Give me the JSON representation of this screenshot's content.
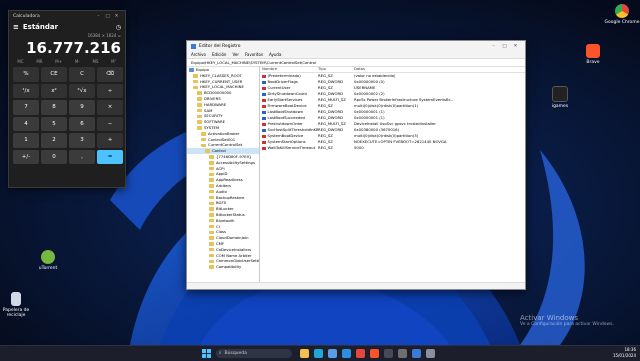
{
  "desktop": {
    "icons": [
      {
        "label": "Google Chrome",
        "color": "#e8453c"
      },
      {
        "label": "Brave",
        "color": "#fb542b"
      },
      {
        "label": "igames",
        "color": "#222222"
      },
      {
        "label": "uTorrent",
        "color": "#76b83f"
      },
      {
        "label": "Papelera de reciclaje",
        "color": "#cfd8e6"
      }
    ],
    "watermark": {
      "line1": "Activar Windows",
      "line2": "Ve a Configuración para activar Windows."
    }
  },
  "calculator": {
    "title": "Calculadora",
    "mode": "Estándar",
    "expression": "16384 × 1024 =",
    "display": "16.777.216",
    "memory": [
      "MC",
      "MR",
      "M+",
      "M-",
      "MS",
      "M˅"
    ],
    "keys": [
      "%",
      "CE",
      "C",
      "⌫",
      "¹/x",
      "x²",
      "²√x",
      "÷",
      "7",
      "8",
      "9",
      "×",
      "4",
      "5",
      "6",
      "−",
      "1",
      "2",
      "3",
      "+",
      "+/-",
      "0",
      ",",
      "="
    ],
    "accent": "#4cc2ff"
  },
  "regedit": {
    "title": "Editor del Registro",
    "menu": [
      "Archivo",
      "Edición",
      "Ver",
      "Favoritos",
      "Ayuda"
    ],
    "address": "Equipo\\HKEY_LOCAL_MACHINE\\SYSTEM\\CurrentControlSet\\Control",
    "tree": [
      {
        "label": "Equipo",
        "indent": 0
      },
      {
        "label": "HKEY_CLASSES_ROOT",
        "indent": 1
      },
      {
        "label": "HKEY_CURRENT_USER",
        "indent": 1
      },
      {
        "label": "HKEY_LOCAL_MACHINE",
        "indent": 1
      },
      {
        "label": "BCD00000000",
        "indent": 2
      },
      {
        "label": "DRIVERS",
        "indent": 2
      },
      {
        "label": "HARDWARE",
        "indent": 2
      },
      {
        "label": "SAM",
        "indent": 2
      },
      {
        "label": "SECURITY",
        "indent": 2
      },
      {
        "label": "SOFTWARE",
        "indent": 2
      },
      {
        "label": "SYSTEM",
        "indent": 2
      },
      {
        "label": "ActivationBroker",
        "indent": 3
      },
      {
        "label": "ControlSet001",
        "indent": 3
      },
      {
        "label": "CurrentControlSet",
        "indent": 3
      },
      {
        "label": "Control",
        "indent": 4,
        "selected": true
      },
      {
        "label": "{7746D80F-97E0}",
        "indent": 5
      },
      {
        "label": "AccessibilitySettings",
        "indent": 5
      },
      {
        "label": "ACPI",
        "indent": 5
      },
      {
        "label": "AppID",
        "indent": 5
      },
      {
        "label": "AppReadiness",
        "indent": 5
      },
      {
        "label": "Arbiters",
        "indent": 5
      },
      {
        "label": "Audio",
        "indent": 5
      },
      {
        "label": "BackupRestore",
        "indent": 5
      },
      {
        "label": "BGFX",
        "indent": 5
      },
      {
        "label": "BitLocker",
        "indent": 5
      },
      {
        "label": "BitlockerStatus",
        "indent": 5
      },
      {
        "label": "Bluetooth",
        "indent": 5
      },
      {
        "label": "CI",
        "indent": 5
      },
      {
        "label": "Class",
        "indent": 5
      },
      {
        "label": "CloudDomainJoin",
        "indent": 5
      },
      {
        "label": "CMF",
        "indent": 5
      },
      {
        "label": "CoDeviceInstallers",
        "indent": 5
      },
      {
        "label": "COM Name Arbiter",
        "indent": 5
      },
      {
        "label": "CommonGlobUserSettings",
        "indent": 5
      },
      {
        "label": "Compatibility",
        "indent": 5
      }
    ],
    "columns": [
      "Nombre",
      "Tipo",
      "Datos"
    ],
    "values": [
      {
        "name": "(Predeterminado)",
        "type": "REG_SZ",
        "data": "(valor no establecido)",
        "icon": "ab"
      },
      {
        "name": "BootDriverFlags",
        "type": "REG_DWORD",
        "data": "0x00000000 (0)",
        "icon": "bin"
      },
      {
        "name": "CurrentUser",
        "type": "REG_SZ",
        "data": "USERNAME",
        "icon": "ab"
      },
      {
        "name": "DirtyShutdownCount",
        "type": "REG_DWORD",
        "data": "0x00000002 (2)",
        "icon": "bin"
      },
      {
        "name": "EarlyStartServices",
        "type": "REG_MULTI_SZ",
        "data": "RpcSs Power BrokerInfrastructure SystemEventsBr...",
        "icon": "ab"
      },
      {
        "name": "FirmwareBootDevice",
        "type": "REG_SZ",
        "data": "multi(0)disk(0)rdisk(0)partition(1)",
        "icon": "ab"
      },
      {
        "name": "LastBootShutdown",
        "type": "REG_DWORD",
        "data": "0x00000001 (1)",
        "icon": "bin"
      },
      {
        "name": "LastBootSucceeded",
        "type": "REG_DWORD",
        "data": "0x00000001 (1)",
        "icon": "bin"
      },
      {
        "name": "PreshutdownOrder",
        "type": "REG_MULTI_SZ",
        "data": "DeviceInstall UsoSvc gpsvc trustedinstaller",
        "icon": "ab"
      },
      {
        "name": "SvcHostSplitThresholdInKB",
        "type": "REG_DWORD",
        "data": "0x00380000 (3670016)",
        "icon": "bin"
      },
      {
        "name": "SystemBootDevice",
        "type": "REG_SZ",
        "data": "multi(0)disk(0)rdisk(0)partition(3)",
        "icon": "ab"
      },
      {
        "name": "SystemStartOptions",
        "type": "REG_SZ",
        "data": "NOEXECUTE=OPTIN FVEBOOT=2621440 NOVGA",
        "icon": "ab"
      },
      {
        "name": "WaitToKillServiceTimeout",
        "type": "REG_SZ",
        "data": "5000",
        "icon": "ab"
      }
    ]
  },
  "taskbar": {
    "search_placeholder": "Búsqueda",
    "apps": [
      {
        "name": "file-explorer",
        "color": "#f2c14e"
      },
      {
        "name": "edge",
        "color": "#1fa5d6"
      },
      {
        "name": "store",
        "color": "#5a9ce8"
      },
      {
        "name": "vscode",
        "color": "#2d8ee0"
      },
      {
        "name": "chrome",
        "color": "#e8453c"
      },
      {
        "name": "brave",
        "color": "#fb542b"
      },
      {
        "name": "terminal",
        "color": "#444a5a"
      },
      {
        "name": "calculator",
        "color": "#6f6f6f"
      },
      {
        "name": "regedit",
        "color": "#3a7bd5"
      },
      {
        "name": "settings",
        "color": "#8a8fa0"
      }
    ],
    "time": "18:36",
    "date": "15/01/2024"
  }
}
